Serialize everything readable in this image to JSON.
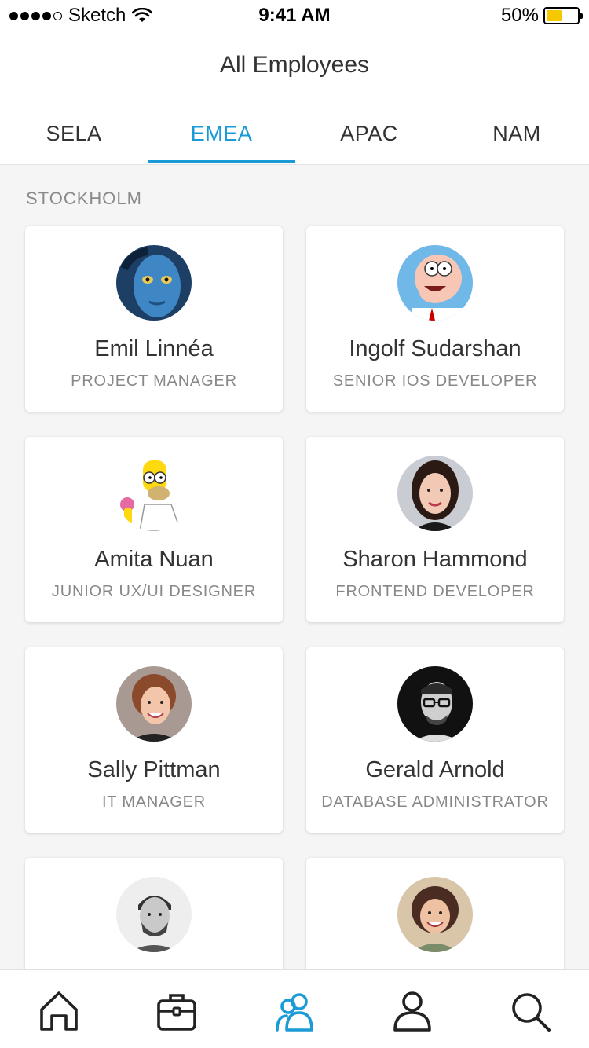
{
  "status_bar": {
    "carrier": "Sketch",
    "time": "9:41 AM",
    "battery_percent": "50%",
    "battery_level": 0.5,
    "signal_bars": 4,
    "icons": [
      "signal-dots-icon",
      "wifi-icon",
      "battery-icon"
    ]
  },
  "header": {
    "title": "All Employees"
  },
  "tabs": [
    {
      "label": "SELA",
      "active": false
    },
    {
      "label": "EMEA",
      "active": true
    },
    {
      "label": "APAC",
      "active": false
    },
    {
      "label": "NAM",
      "active": false
    }
  ],
  "section": {
    "title": "STOCKHOLM"
  },
  "employees": [
    {
      "name": "Emil Linnéa",
      "role": "PROJECT MANAGER",
      "avatar": "blue-alien-avatar"
    },
    {
      "name": "Ingolf Sudarshan",
      "role": "SENIOR IOS DEVELOPER",
      "avatar": "cartoon-man-avatar"
    },
    {
      "name": "Amita Nuan",
      "role": "JUNIOR UX/UI DESIGNER",
      "avatar": "cartoon-yellow-man-avatar"
    },
    {
      "name": "Sharon Hammond",
      "role": "FRONTEND DEVELOPER",
      "avatar": "woman-dark-hair-avatar"
    },
    {
      "name": "Sally Pittman",
      "role": "IT MANAGER",
      "avatar": "woman-short-hair-avatar"
    },
    {
      "name": "Gerald Arnold",
      "role": "DATABASE ADMINISTRATOR",
      "avatar": "man-glasses-avatar"
    },
    {
      "name": "",
      "role": "",
      "avatar": "man-beard-avatar"
    },
    {
      "name": "",
      "role": "",
      "avatar": "woman-smiling-avatar"
    }
  ],
  "tab_bar": {
    "items": [
      {
        "icon": "home-icon",
        "active": false
      },
      {
        "icon": "briefcase-icon",
        "active": false
      },
      {
        "icon": "people-icon",
        "active": true
      },
      {
        "icon": "person-icon",
        "active": false
      },
      {
        "icon": "search-icon",
        "active": false
      }
    ]
  },
  "colors": {
    "accent": "#1a9bd7",
    "text": "#333333",
    "muted": "#888888",
    "background": "#f5f5f5",
    "battery": "#f6c800"
  }
}
